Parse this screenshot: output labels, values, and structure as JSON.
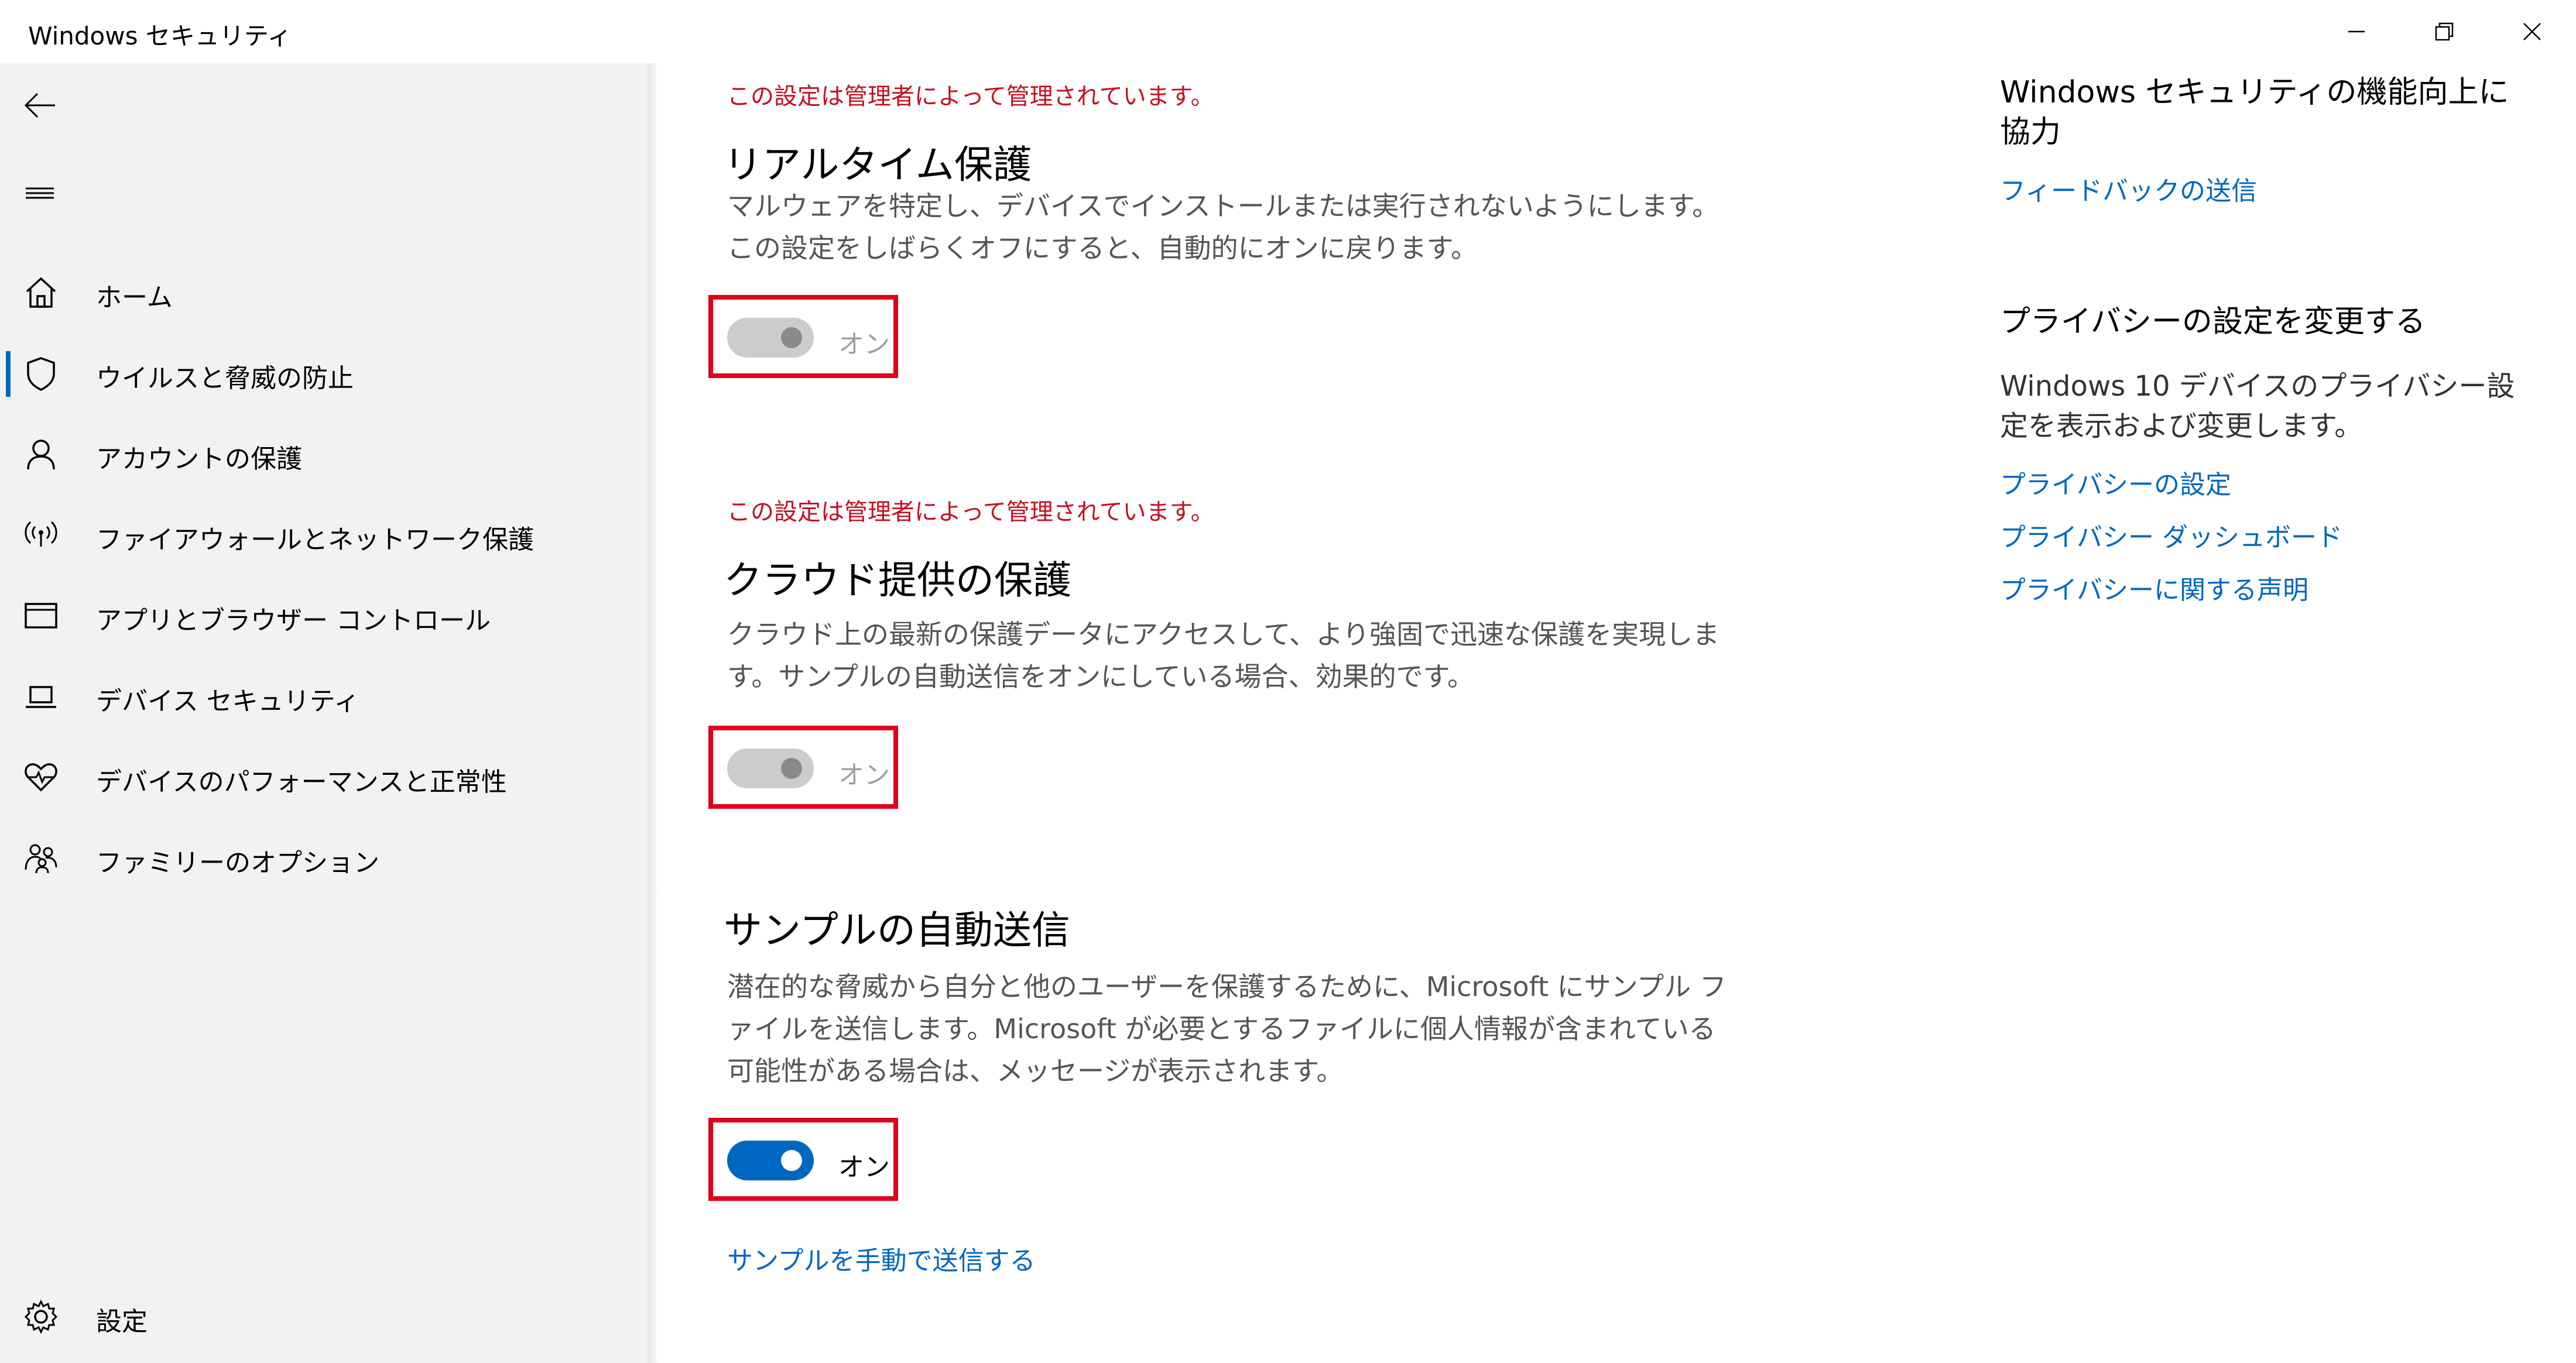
{
  "window": {
    "title": "Windows セキュリティ"
  },
  "sidebar": {
    "items": [
      {
        "label": "ホーム",
        "icon": "home-icon"
      },
      {
        "label": "ウイルスと脅威の防止",
        "icon": "shield-icon",
        "selected": true
      },
      {
        "label": "アカウントの保護",
        "icon": "person-icon"
      },
      {
        "label": "ファイアウォールとネットワーク保護",
        "icon": "wireless-icon"
      },
      {
        "label": "アプリとブラウザー コントロール",
        "icon": "app-window-icon"
      },
      {
        "label": "デバイス セキュリティ",
        "icon": "laptop-icon"
      },
      {
        "label": "デバイスのパフォーマンスと正常性",
        "icon": "heart-pulse-icon"
      },
      {
        "label": "ファミリーのオプション",
        "icon": "family-icon"
      }
    ],
    "settings_label": "設定"
  },
  "main": {
    "realtime": {
      "managed_notice": "この設定は管理者によって管理されています。",
      "title": "リアルタイム保護",
      "description": "マルウェアを特定し、デバイスでインストールまたは実行されないようにします。この設定をしばらくオフにすると、自動的にオンに戻ります。",
      "toggle_state": "オン",
      "toggle_on": true,
      "toggle_enabled": false
    },
    "cloud": {
      "managed_notice": "この設定は管理者によって管理されています。",
      "title": "クラウド提供の保護",
      "description": "クラウド上の最新の保護データにアクセスして、より強固で迅速な保護を実現します。サンプルの自動送信をオンにしている場合、効果的です。",
      "toggle_state": "オン",
      "toggle_on": true,
      "toggle_enabled": false
    },
    "sample": {
      "title": "サンプルの自動送信",
      "description": "潜在的な脅威から自分と他のユーザーを保護するために、Microsoft にサンプル ファイルを送信します。Microsoft が必要とするファイルに個人情報が含まれている可能性がある場合は、メッセージが表示されます。",
      "toggle_state": "オン",
      "toggle_on": true,
      "toggle_enabled": true,
      "manual_link": "サンプルを手動で送信する"
    }
  },
  "right": {
    "feedback": {
      "heading": "Windows セキュリティの機能向上に協力",
      "link": "フィードバックの送信"
    },
    "privacy": {
      "heading": "プライバシーの設定を変更する",
      "text": "Windows 10 デバイスのプライバシー設定を表示および変更します。",
      "links": [
        "プライバシーの設定",
        "プライバシー ダッシュボード",
        "プライバシーに関する声明"
      ]
    }
  },
  "colors": {
    "accent": "#0067c0",
    "managed_text": "#c50f1f",
    "highlight_border": "#e0001b",
    "sidebar_bg": "#f2f2f2"
  }
}
